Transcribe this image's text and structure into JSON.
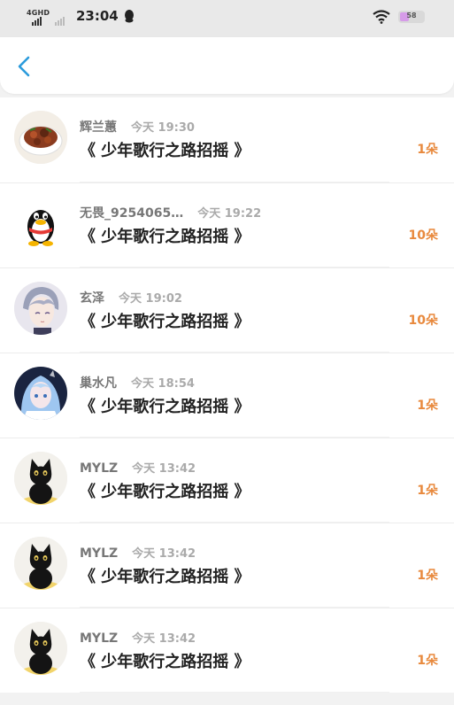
{
  "status_bar": {
    "network": "4GHD",
    "time": "23:04",
    "battery": "58"
  },
  "header": {
    "back_icon": "chevron-left-icon",
    "accent_color": "#2b9bdc"
  },
  "gift_records": [
    {
      "user": "辉兰蕙",
      "time": "今天 19:30",
      "title": "《 少年歌行之路招摇 》",
      "count": "1朵",
      "avatar": "food-photo"
    },
    {
      "user": "无畏_9254065…",
      "time": "今天 19:22",
      "title": "《 少年歌行之路招摇 》",
      "count": "10朵",
      "avatar": "qq-penguin"
    },
    {
      "user": "玄泽",
      "time": "今天 19:02",
      "title": "《 少年歌行之路招摇 》",
      "count": "10朵",
      "avatar": "anime-boy"
    },
    {
      "user": "巢水凡",
      "time": "今天 18:54",
      "title": "《 少年歌行之路招摇 》",
      "count": "1朵",
      "avatar": "anime-blue-hair"
    },
    {
      "user": "MYLZ",
      "time": "今天 13:42",
      "title": "《 少年歌行之路招摇 》",
      "count": "1朵",
      "avatar": "black-cat"
    },
    {
      "user": "MYLZ",
      "time": "今天 13:42",
      "title": "《 少年歌行之路招摇 》",
      "count": "1朵",
      "avatar": "black-cat"
    },
    {
      "user": "MYLZ",
      "time": "今天 13:42",
      "title": "《 少年歌行之路招摇 》",
      "count": "1朵",
      "avatar": "black-cat"
    }
  ],
  "colors": {
    "count": "#e8893d",
    "username": "#777777",
    "timestamp": "#aaaaaa"
  }
}
